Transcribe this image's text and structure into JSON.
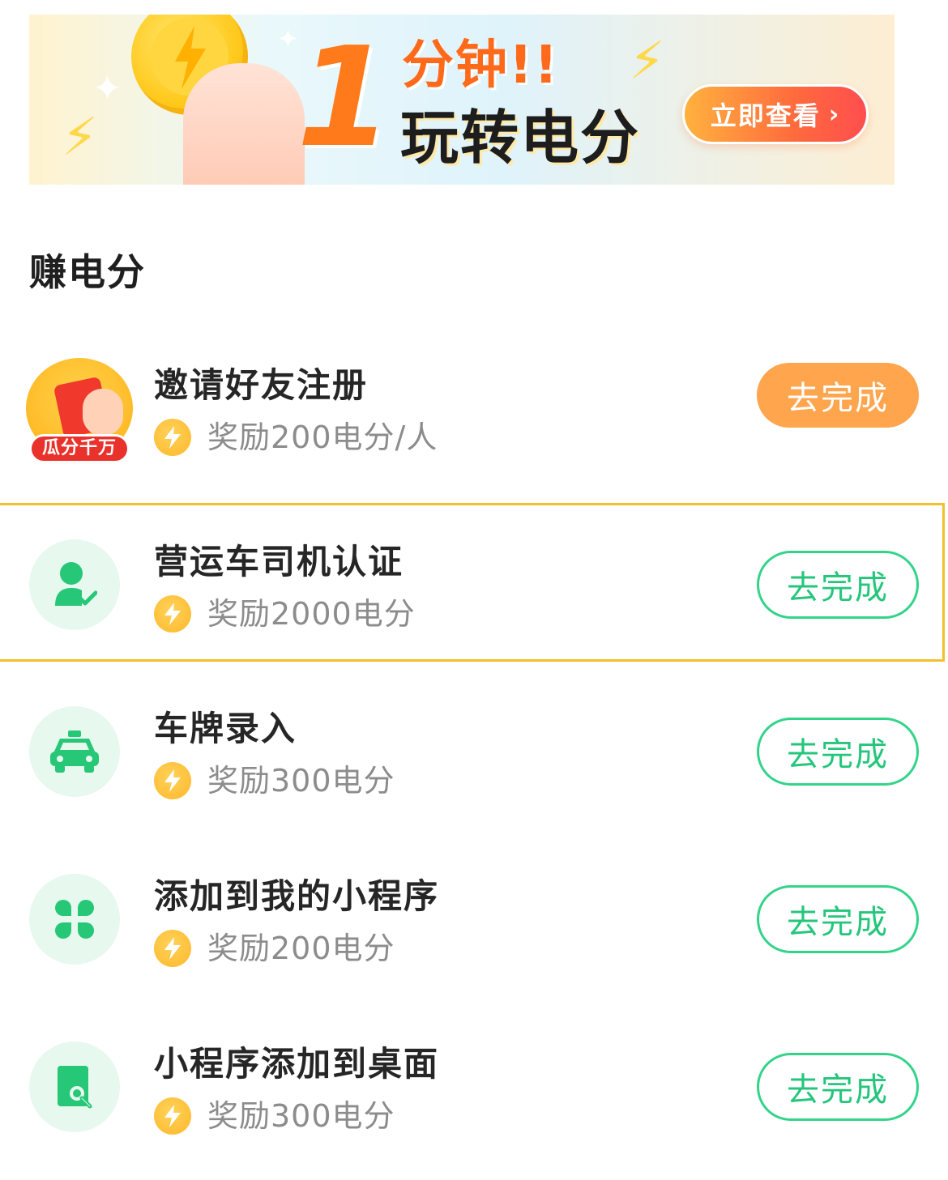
{
  "banner": {
    "big_number": "1",
    "line1": "分钟!!",
    "line2": "玩转电分",
    "button_label": "立即查看",
    "button_chevron": "›"
  },
  "section_title": "赚电分",
  "tasks": [
    {
      "icon": "invite-red-envelope-icon",
      "badge": "瓜分千万",
      "title": "邀请好友注册",
      "reward": "奖励200电分/人",
      "button": "去完成",
      "button_style": "filled"
    },
    {
      "icon": "driver-verified-icon",
      "title": "营运车司机认证",
      "reward": "奖励2000电分",
      "button": "去完成",
      "button_style": "outline",
      "highlighted": true
    },
    {
      "icon": "taxi-icon",
      "title": "车牌录入",
      "reward": "奖励300电分",
      "button": "去完成",
      "button_style": "outline"
    },
    {
      "icon": "clover-grid-icon",
      "title": "添加到我的小程序",
      "reward": "奖励200电分",
      "button": "去完成",
      "button_style": "outline"
    },
    {
      "icon": "search-document-icon",
      "title": "小程序添加到桌面",
      "reward": "奖励300电分",
      "button": "去完成",
      "button_style": "outline"
    }
  ],
  "colors": {
    "accent_green": "#24c67b",
    "accent_orange": "#ffa54d",
    "highlight_border": "#f3c02b",
    "icon_bg": "#e7f8ee"
  }
}
